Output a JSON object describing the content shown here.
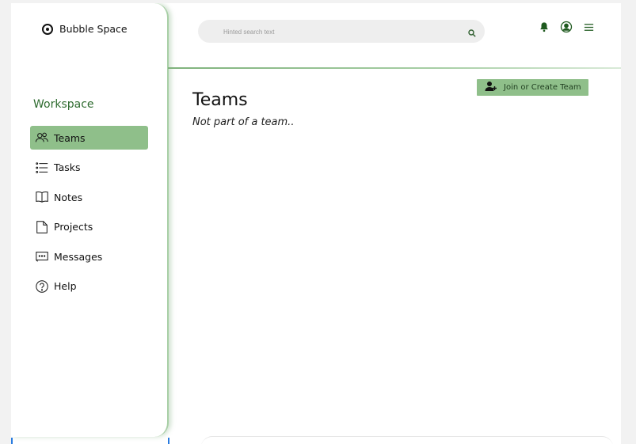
{
  "brand": {
    "name": "Bubble Space"
  },
  "sidebar": {
    "section_label": "Workspace",
    "items": [
      {
        "label": "Teams",
        "icon": "users-icon",
        "active": true
      },
      {
        "label": "Tasks",
        "icon": "list-icon",
        "active": false
      },
      {
        "label": "Notes",
        "icon": "book-icon",
        "active": false
      },
      {
        "label": "Projects",
        "icon": "file-icon",
        "active": false
      },
      {
        "label": "Messages",
        "icon": "message-icon",
        "active": false
      },
      {
        "label": "Help",
        "icon": "help-icon",
        "active": false
      }
    ]
  },
  "header": {
    "search_placeholder": "Hinted search text",
    "icons": [
      "bell-icon",
      "user-icon",
      "menu-icon"
    ]
  },
  "main": {
    "title": "Teams",
    "action_label": "Join or Create Team",
    "empty_message": "Not part of a team.."
  },
  "colors": {
    "accent": "#8fbf8a",
    "accent_text": "#2e6b2f",
    "divider": "#a8cfa6"
  }
}
